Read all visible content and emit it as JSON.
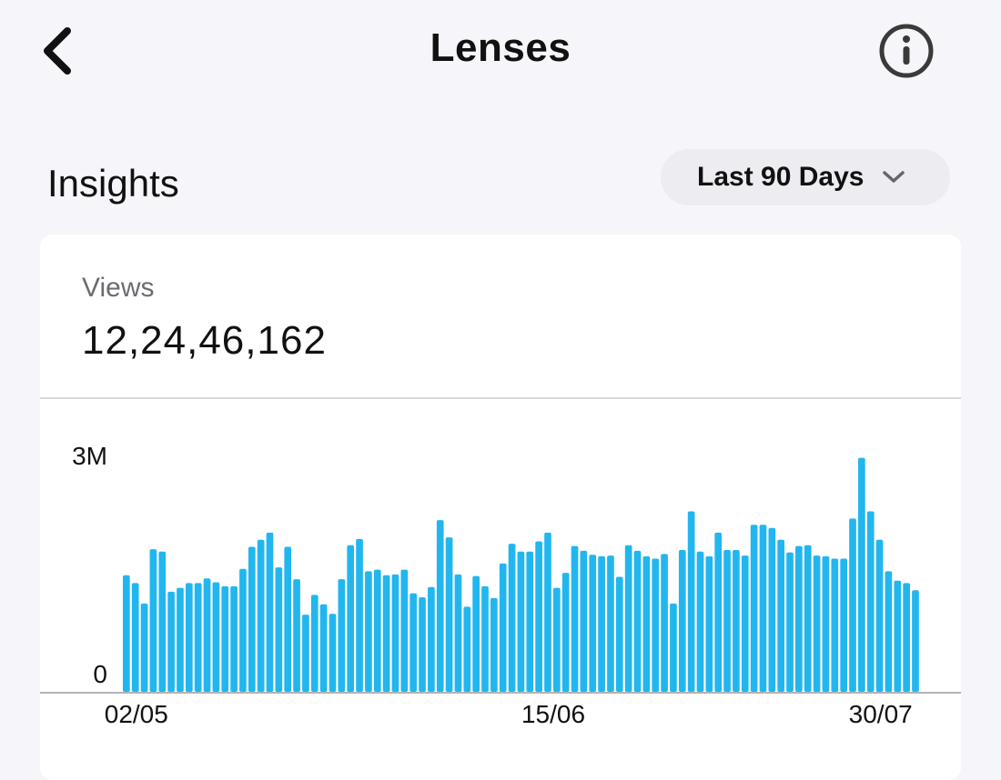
{
  "header": {
    "title": "Lenses",
    "back_icon": "chevron-left-icon",
    "info_icon": "info-icon"
  },
  "section": {
    "title": "Insights"
  },
  "range": {
    "label": "Last 90 Days",
    "icon": "chevron-down-icon"
  },
  "metric": {
    "label": "Views",
    "value": "12,24,46,162"
  },
  "colors": {
    "bar": "#22b6ef",
    "background": "#f6f6fa"
  },
  "chart_data": {
    "type": "bar",
    "xlabel": "",
    "ylabel": "",
    "ylim": [
      0,
      3000000
    ],
    "y_ticks": [
      {
        "value": 0,
        "label": "0"
      },
      {
        "value": 3000000,
        "label": "3M"
      }
    ],
    "x_tick_labels": [
      "02/05",
      "15/06",
      "30/07"
    ],
    "grid": false,
    "values": [
      1480000,
      1380000,
      1120000,
      1810000,
      1780000,
      1270000,
      1320000,
      1380000,
      1380000,
      1440000,
      1390000,
      1340000,
      1340000,
      1560000,
      1840000,
      1930000,
      2020000,
      1580000,
      1840000,
      1430000,
      980000,
      1230000,
      1110000,
      990000,
      1430000,
      1860000,
      1940000,
      1530000,
      1550000,
      1480000,
      1490000,
      1550000,
      1250000,
      1200000,
      1330000,
      2180000,
      1960000,
      1490000,
      1080000,
      1470000,
      1340000,
      1190000,
      1630000,
      1880000,
      1780000,
      1780000,
      1910000,
      2020000,
      1320000,
      1510000,
      1850000,
      1790000,
      1740000,
      1720000,
      1730000,
      1460000,
      1860000,
      1790000,
      1720000,
      1690000,
      1750000,
      1120000,
      1800000,
      2290000,
      1780000,
      1720000,
      2020000,
      1800000,
      1800000,
      1730000,
      2120000,
      2120000,
      2080000,
      1930000,
      1770000,
      1850000,
      1860000,
      1730000,
      1720000,
      1690000,
      1690000,
      2200000,
      2970000,
      2290000,
      1930000,
      1530000,
      1410000,
      1380000,
      1290000
    ]
  }
}
